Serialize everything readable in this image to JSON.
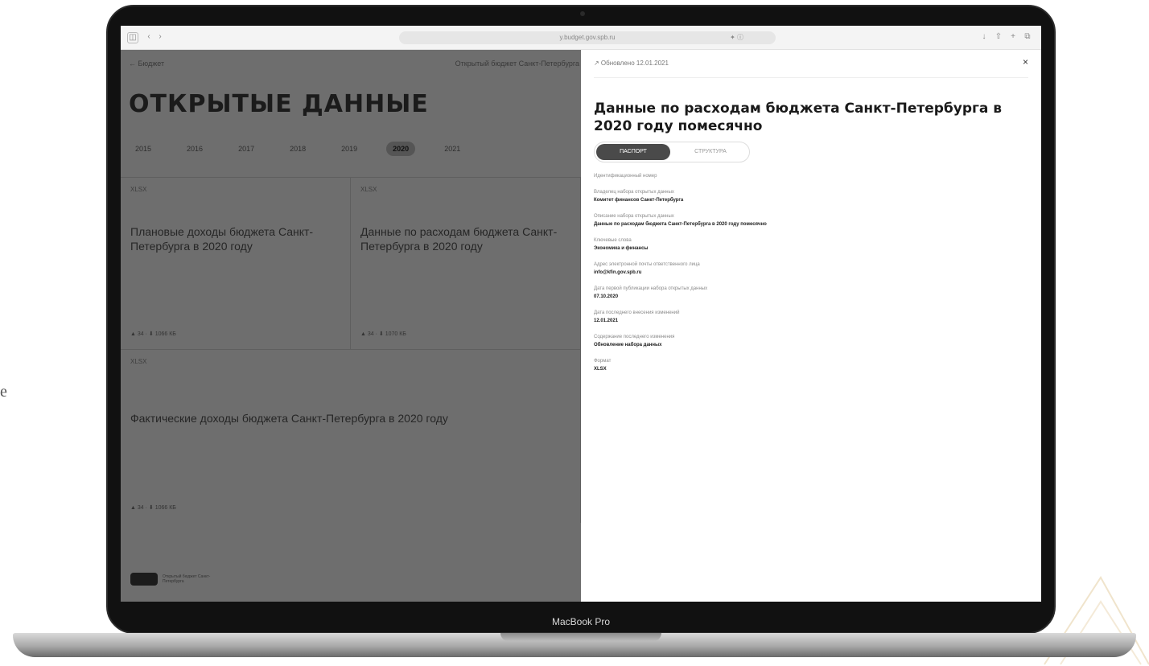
{
  "side_char": "e",
  "device": {
    "model": "MacBook Pro"
  },
  "browser": {
    "url": "y.budget.gov.spb.ru",
    "reader_label": "✦ ⓘ",
    "buttons": {
      "sidebar": "◫",
      "back": "‹",
      "forward": "›",
      "share": "⇧",
      "new_tab": "+",
      "tabs": "⧉",
      "download": "↓"
    }
  },
  "left_page": {
    "breadcrumb": "← Бюджет",
    "subtitle": "Открытый бюджет Санкт-Петербурга",
    "title": "ОТКРЫТЫЕ ДАННЫЕ",
    "years": [
      {
        "label": "2015"
      },
      {
        "label": "2016"
      },
      {
        "label": "2017"
      },
      {
        "label": "2018"
      },
      {
        "label": "2019"
      },
      {
        "label": "2020"
      },
      {
        "label": "2021"
      }
    ],
    "active_year": "2020",
    "cards": [
      {
        "tag": "XLSX",
        "title": "Плановые доходы бюджета Санкт-Петербурга в 2020 году",
        "meta": "▲ 34 · ⬇ 1066 КБ"
      },
      {
        "tag": "XLSX",
        "title": "Данные по расходам бюджета Санкт-Петербурга в 2020 году",
        "meta": "▲ 34 · ⬇ 1070 КБ"
      },
      {
        "tag": "XLSX",
        "title": "Фактические доходы бюджета Санкт-Петербурга в 2020 году",
        "meta": "▲ 34 · ⬇ 1066 КБ"
      }
    ],
    "logo_text": "Открытый бюджет Санкт-Петербурга"
  },
  "right_panel": {
    "top_link": "↗ Обновлено 12.01.2021",
    "close": "×",
    "title": "Данные по расходам бюджета Санкт-Петербурга в 2020 году помесячно",
    "tabs": {
      "active": "ПАСПОРТ",
      "inactive": "СТРУКТУРА"
    },
    "fields": [
      {
        "label": "Идентификационный номер",
        "value": ""
      },
      {
        "label": "Владелец набора открытых данных",
        "value": "Комитет финансов Санкт-Петербурга"
      },
      {
        "label": "Описание набора открытых данных",
        "value": "Данные по расходам бюджета Санкт-Петербурга в 2020 году помесячно"
      },
      {
        "label": "Ключевые слова",
        "value": "Экономика и финансы"
      },
      {
        "label": "Адрес электронной почты ответственного лица",
        "value": "info@kfin.gov.spb.ru"
      },
      {
        "label": "Дата первой публикации набора открытых данных",
        "value": "07.10.2020"
      },
      {
        "label": "Дата последнего внесения изменений",
        "value": "12.01.2021"
      },
      {
        "label": "Содержание последнего изменения",
        "value": "Обновление набора данных"
      },
      {
        "label": "Формат",
        "value": "XLSX"
      }
    ]
  }
}
